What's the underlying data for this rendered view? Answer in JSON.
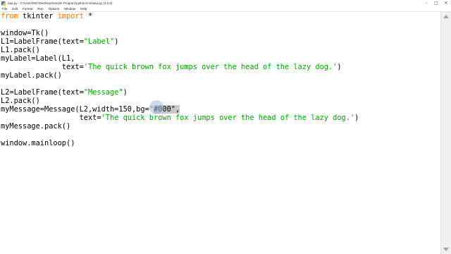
{
  "window": {
    "title": "aaa.py - C:\\Users\\MC\\Desktop\\Sample Program\\python\\con\\aaa.py (3.6.5)",
    "min_label": "–",
    "max_label": "□",
    "close_label": "✕"
  },
  "menu": [
    "File",
    "Edit",
    "Format",
    "Run",
    "Options",
    "Window",
    "Help"
  ],
  "code": {
    "l1": {
      "kw1": "from",
      "mid": " tkinter ",
      "kw2": "import",
      "rest": " *"
    },
    "l3": "window=Tk()",
    "l4": {
      "a": "L1=LabelFrame(text=",
      "s": "\"Label\"",
      "b": ")"
    },
    "l5": "L1.pack()",
    "l6": "myLabel=Label(L1,",
    "l7": {
      "a": "              text=",
      "s": "'The quick brown fox jumps over the head of the lazy dog.'",
      "b": ")"
    },
    "l8": "myLabel.pack()",
    "l10": {
      "a": "L2=LabelFrame(text=",
      "s": "\"Message\"",
      "b": ")"
    },
    "l11": "L2.pack()",
    "l12": {
      "a": "myMessage=Message(L2,width=150,bg=",
      "s1": "\"",
      "sel": "#000\",",
      "b": ""
    },
    "l13": {
      "a": "                  text=",
      "s": "'The quick brown fox jumps over the head of the lazy dog.'",
      "b": ")"
    },
    "l14": "myMessage.pack()",
    "l16": "window.mainloop()"
  },
  "colors": {
    "keyword": "#ff7700",
    "string": "#00aa00",
    "selection": "#c8c8c8",
    "text": "#000000"
  }
}
